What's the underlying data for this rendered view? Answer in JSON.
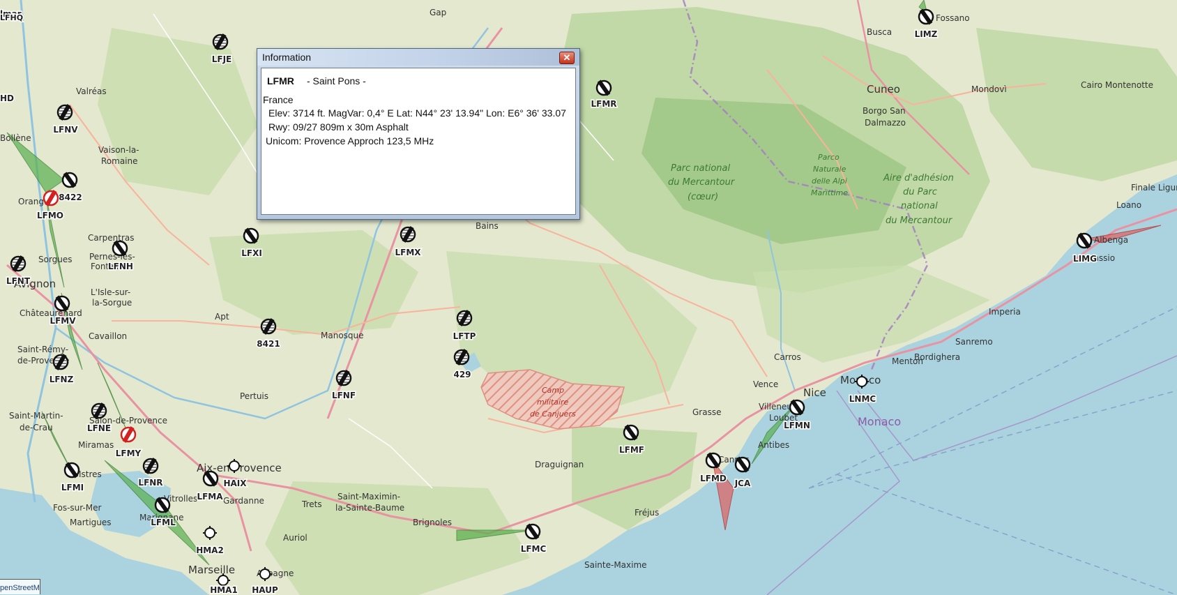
{
  "map": {
    "places": [
      {
        "id": "gap",
        "label": "Gap"
      },
      {
        "id": "fossano",
        "label": "Fossano"
      },
      {
        "id": "busca",
        "label": "Busca"
      },
      {
        "id": "cuneo",
        "label": "Cuneo"
      },
      {
        "id": "mondovi",
        "label": "Mondovì"
      },
      {
        "id": "cairo",
        "label": "Cairo Montenotte"
      },
      {
        "id": "borgo",
        "label": "Borgo San"
      },
      {
        "id": "dalmazzo",
        "label": "Dalmazzo"
      },
      {
        "id": "valreas",
        "label": "Valréas"
      },
      {
        "id": "vaison1",
        "label": "Vaison-la-"
      },
      {
        "id": "vaison2",
        "label": "Romaine"
      },
      {
        "id": "bollene",
        "label": "Bollène"
      },
      {
        "id": "orange",
        "label": "Orange"
      },
      {
        "id": "carpentras",
        "label": "Carpentras"
      },
      {
        "id": "pernes1",
        "label": "Pernes-les-"
      },
      {
        "id": "pernes2",
        "label": "Fontaines"
      },
      {
        "id": "sorgues",
        "label": "Sorgues"
      },
      {
        "id": "avignon",
        "label": "Avignon"
      },
      {
        "id": "isle1",
        "label": "L'Isle-sur-"
      },
      {
        "id": "isle2",
        "label": "la-Sorgue"
      },
      {
        "id": "chateau",
        "label": "Châteaurenard"
      },
      {
        "id": "cavaillon",
        "label": "Cavaillon"
      },
      {
        "id": "remy1",
        "label": "Saint-Rémy-"
      },
      {
        "id": "remy2",
        "label": "de-Provence"
      },
      {
        "id": "apt",
        "label": "Apt"
      },
      {
        "id": "manosque",
        "label": "Manosque"
      },
      {
        "id": "pertuis",
        "label": "Pertuis"
      },
      {
        "id": "bains",
        "label": "Bains"
      },
      {
        "id": "stmartin1",
        "label": "Saint-Martin-"
      },
      {
        "id": "stmartin2",
        "label": "de-Crau"
      },
      {
        "id": "salon",
        "label": "Salon-de-Provence"
      },
      {
        "id": "miramas",
        "label": "Miramas"
      },
      {
        "id": "istres",
        "label": "Istres"
      },
      {
        "id": "aix",
        "label": "Aix-en-Provence"
      },
      {
        "id": "fos",
        "label": "Fos-sur-Mer"
      },
      {
        "id": "martigues",
        "label": "Martigues"
      },
      {
        "id": "marignane",
        "label": "Marignane"
      },
      {
        "id": "vitrolles",
        "label": "Vitrolles"
      },
      {
        "id": "gardanne",
        "label": "Gardanne"
      },
      {
        "id": "trets",
        "label": "Trets"
      },
      {
        "id": "stmaximin1",
        "label": "Saint-Maximin-"
      },
      {
        "id": "stmaximin2",
        "label": "la-Sainte-Baume"
      },
      {
        "id": "brignoles",
        "label": "Brignoles"
      },
      {
        "id": "auriol",
        "label": "Auriol"
      },
      {
        "id": "marseille",
        "label": "Marseille"
      },
      {
        "id": "aubagne",
        "label": "Aubagne"
      },
      {
        "id": "draguignan",
        "label": "Draguignan"
      },
      {
        "id": "grasse",
        "label": "Grasse"
      },
      {
        "id": "vence",
        "label": "Vence"
      },
      {
        "id": "villeneuve",
        "label": "Villeneuve-"
      },
      {
        "id": "loubet",
        "label": "Loubet"
      },
      {
        "id": "cannes",
        "label": "Cannes"
      },
      {
        "id": "antibes",
        "label": "Antibes"
      },
      {
        "id": "nice",
        "label": "Nice"
      },
      {
        "id": "frejus",
        "label": "Fréjus"
      },
      {
        "id": "stemaxime",
        "label": "Sainte-Maxime"
      },
      {
        "id": "carros",
        "label": "Carros"
      },
      {
        "id": "monaco",
        "label": "Monaco"
      },
      {
        "id": "menton",
        "label": "Menton"
      },
      {
        "id": "bordighera",
        "label": "Bordighera"
      },
      {
        "id": "sanremo",
        "label": "Sanremo"
      },
      {
        "id": "imperia",
        "label": "Imperia"
      },
      {
        "id": "albenga",
        "label": "Albenga"
      },
      {
        "id": "alassio",
        "label": "Alassio"
      },
      {
        "id": "loano",
        "label": "Loano"
      },
      {
        "id": "finale",
        "label": "Finale Ligure"
      }
    ],
    "parks": [
      {
        "id": "mercantour1",
        "label": "Parc national"
      },
      {
        "id": "mercantour2",
        "label": "du Mercantour"
      },
      {
        "id": "mercantour3",
        "label": "(cœur)"
      },
      {
        "id": "alpi1",
        "label": "Parco"
      },
      {
        "id": "alpi2",
        "label": "Naturale"
      },
      {
        "id": "alpi3",
        "label": "delle Alpi"
      },
      {
        "id": "alpi4",
        "label": "Marittime"
      },
      {
        "id": "aire1",
        "label": "Aire d'adhésion"
      },
      {
        "id": "aire2",
        "label": "du Parc"
      },
      {
        "id": "aire3",
        "label": "national"
      },
      {
        "id": "aire4",
        "label": "du Mercantour"
      }
    ],
    "camp": [
      "Camp",
      "militaire",
      "de Canjuers"
    ],
    "country_label": "Monaco",
    "airports": [
      {
        "code": "LFMR",
        "type": "open"
      },
      {
        "code": "LFJE",
        "type": "closed"
      },
      {
        "code": "LFNV",
        "type": "closed"
      },
      {
        "code": "8422",
        "type": "open"
      },
      {
        "code": "LFMO",
        "type": "military"
      },
      {
        "code": "LFXI",
        "type": "open"
      },
      {
        "code": "LFNH",
        "type": "open"
      },
      {
        "code": "LFNT",
        "type": "closed"
      },
      {
        "code": "LFMV",
        "type": "open"
      },
      {
        "code": "LFNZ",
        "type": "closed"
      },
      {
        "code": "LFMX",
        "type": "closed"
      },
      {
        "code": "LFTP",
        "type": "closed"
      },
      {
        "code": "8421",
        "type": "closed"
      },
      {
        "code": "429",
        "type": "closed"
      },
      {
        "code": "LFNF",
        "type": "closed"
      },
      {
        "code": "LFNE",
        "type": "closed"
      },
      {
        "code": "LFMY",
        "type": "military"
      },
      {
        "code": "LFNR",
        "type": "closed"
      },
      {
        "code": "LFMI",
        "type": "open"
      },
      {
        "code": "LFMA",
        "type": "open"
      },
      {
        "code": "HAIX",
        "type": "heli"
      },
      {
        "code": "LFML",
        "type": "open"
      },
      {
        "code": "HMA2",
        "type": "heli"
      },
      {
        "code": "HMA1",
        "type": "heli"
      },
      {
        "code": "HAUP",
        "type": "heli"
      },
      {
        "code": "LFMC",
        "type": "open"
      },
      {
        "code": "LFMF",
        "type": "open"
      },
      {
        "code": "LFMD",
        "type": "open"
      },
      {
        "code": "JCA",
        "type": "open"
      },
      {
        "code": "LFMN",
        "type": "open"
      },
      {
        "code": "LNMC",
        "type": "heli"
      },
      {
        "code": "LIMZ",
        "type": "open"
      },
      {
        "code": "LIMG",
        "type": "open"
      }
    ],
    "edge_labels": [
      "lmar",
      "LFHQ",
      "HD"
    ],
    "attribution": "penStreetMap"
  },
  "info_window": {
    "title": "Information",
    "close_label": "✕",
    "code": "LFMR",
    "name": "- Saint Pons -",
    "country": "France",
    "elev_line": "Elev: 3714 ft. MagVar: 0,4° E Lat: N44° 23' 13.94\" Lon: E6° 36' 33.07",
    "rwy_line": "Rwy: 09/27 809m x 30m Asphalt",
    "unicom_line": "Unicom: Provence Approch 123,5 MHz"
  }
}
